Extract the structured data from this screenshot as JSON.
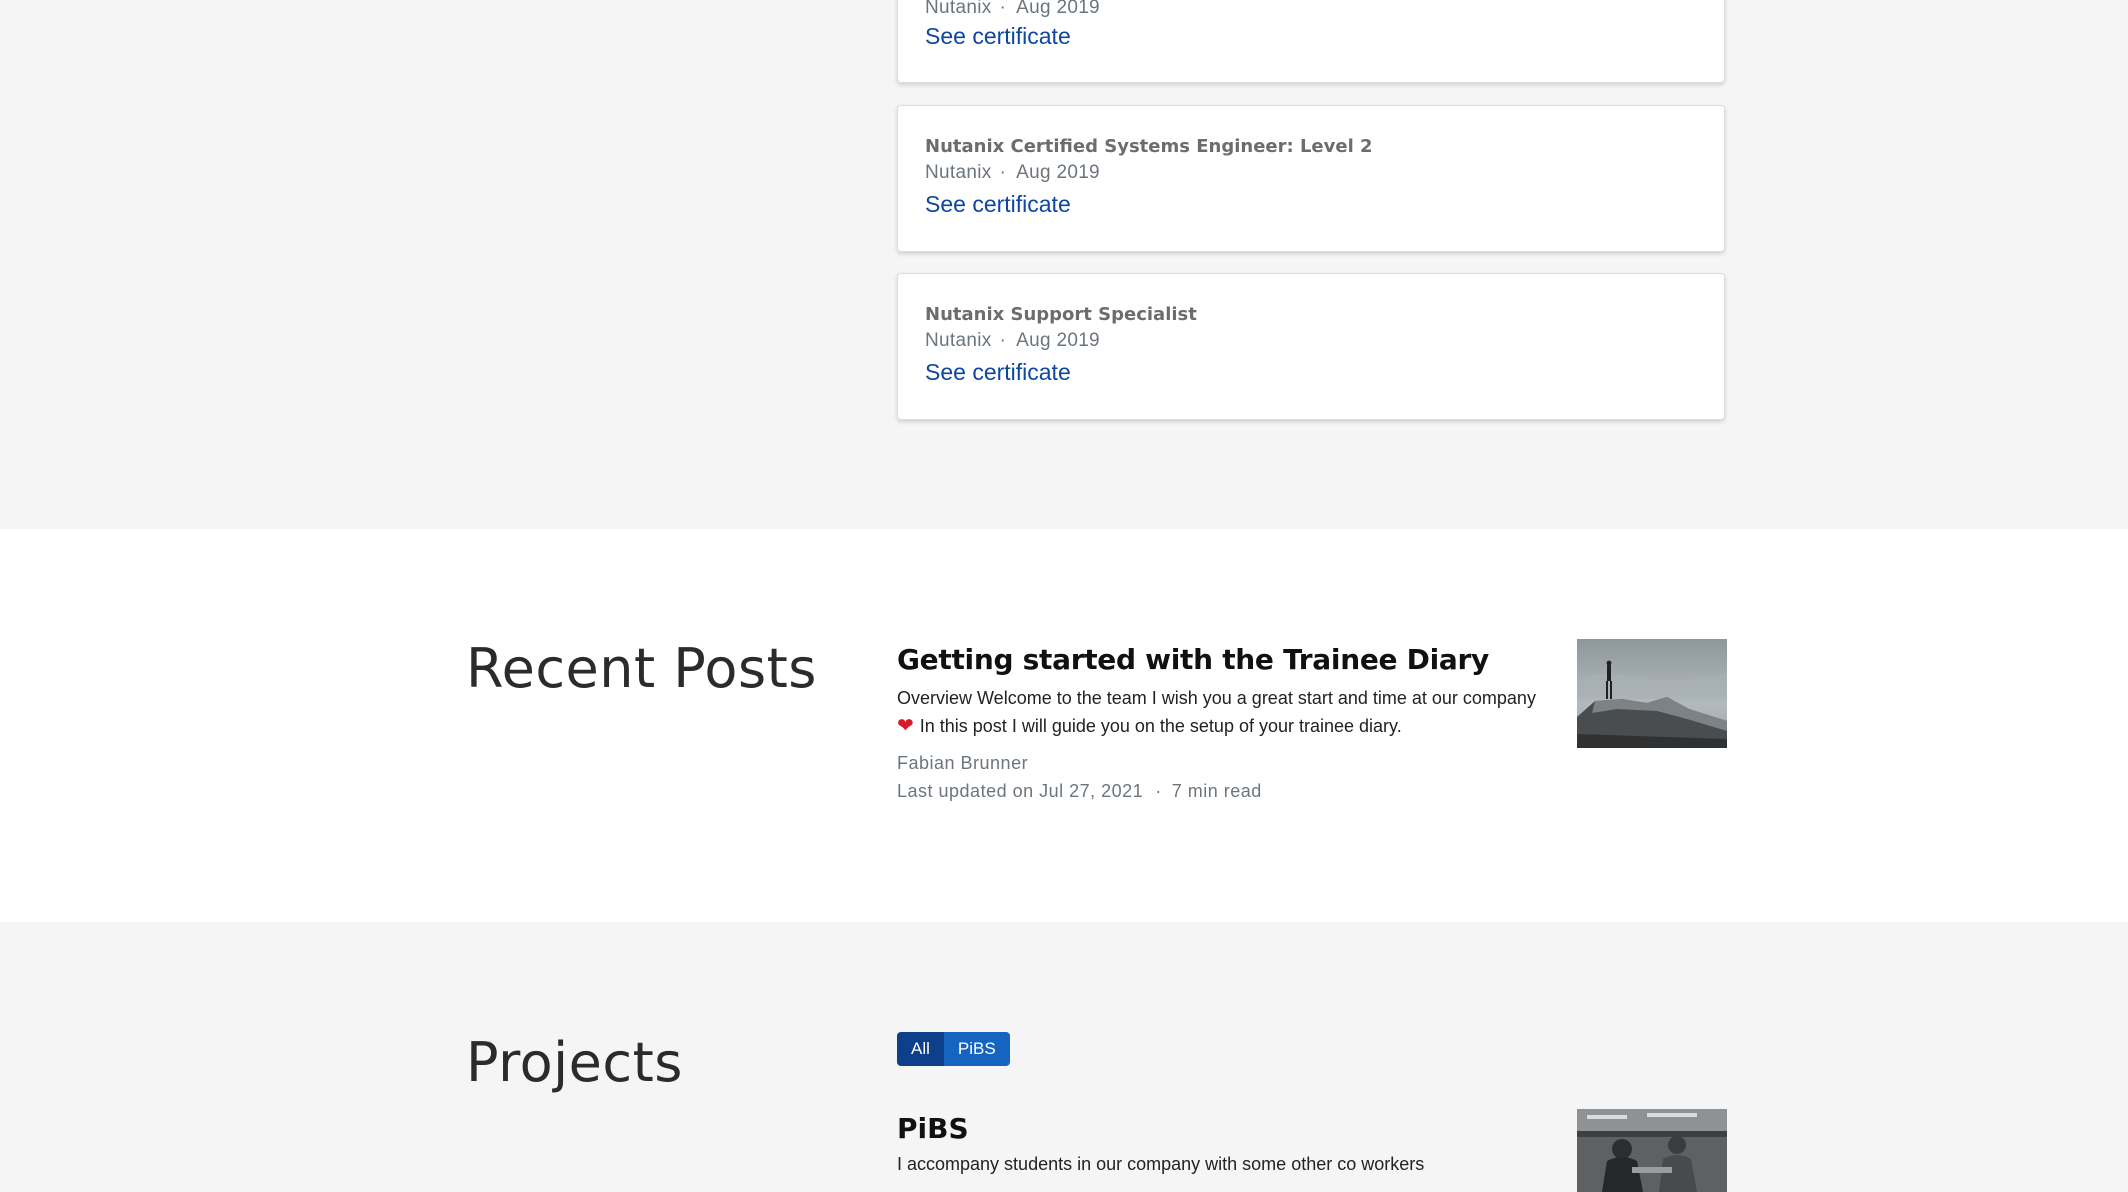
{
  "accomplishments": {
    "cards": [
      {
        "title": "",
        "organization": "Nutanix",
        "date": "Aug 2019",
        "link_label": "See certificate"
      },
      {
        "title": "Nutanix Certified Systems Engineer: Level 2",
        "organization": "Nutanix",
        "date": "Aug 2019",
        "link_label": "See certificate"
      },
      {
        "title": "Nutanix Support Specialist",
        "organization": "Nutanix",
        "date": "Aug 2019",
        "link_label": "See certificate"
      }
    ],
    "separator": "·"
  },
  "recent_posts": {
    "heading": "Recent Posts",
    "posts": [
      {
        "title": "Getting started with the Trainee Diary",
        "summary_line1": "Overview Welcome to the team I wish you a great start and time at our company",
        "summary_line2": "In this post I will guide you on the setup of your trainee diary.",
        "summary_icon": "red-heart-icon",
        "author": "Fabian Brunner",
        "updated": "Last updated on Jul 27, 2021",
        "separator": "·",
        "read_time": "7 min read",
        "thumbnail": "person-standing-on-rock-photo"
      }
    ]
  },
  "projects": {
    "heading": "Projects",
    "filters": [
      {
        "label": "All",
        "active": true
      },
      {
        "label": "PiBS",
        "active": false
      }
    ],
    "items": [
      {
        "title": "PiBS",
        "summary": "I accompany students in our company with some other co workers",
        "thumbnail": "people-working-photo"
      }
    ]
  },
  "colors": {
    "accent_link": "#0d47a1",
    "filter_active": "#0d3f8a",
    "filter_inactive": "#1565c0",
    "section_grey": "#f5f5f5"
  }
}
